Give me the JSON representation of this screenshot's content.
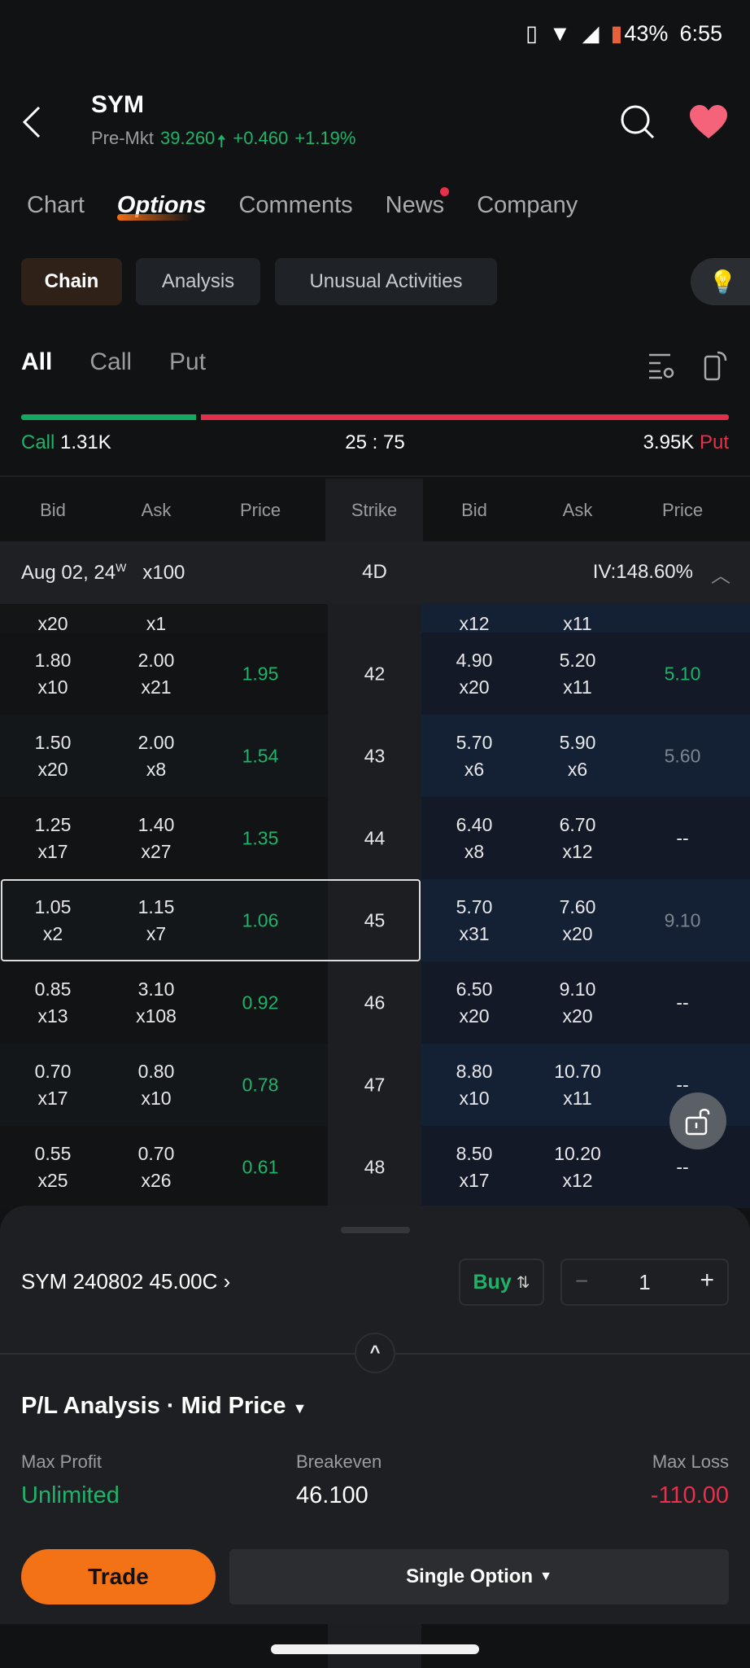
{
  "status": {
    "battery": "43%",
    "time": "6:55"
  },
  "header": {
    "symbol": "SYM",
    "session": "Pre-Mkt",
    "price": "39.260",
    "change": "+0.460",
    "change_pct": "+1.19%"
  },
  "tabs": [
    "Chart",
    "Options",
    "Comments",
    "News",
    "Company"
  ],
  "subtabs": [
    "Chain",
    "Analysis",
    "Unusual Activities"
  ],
  "filters": [
    "All",
    "Call",
    "Put"
  ],
  "ratio": {
    "call_label": "Call",
    "call_volume": "1.31K",
    "ratio": "25 : 75",
    "put_volume": "3.95K",
    "put_label": "Put",
    "call_fraction": 0.25
  },
  "columns": {
    "bid": "Bid",
    "ask": "Ask",
    "price": "Price",
    "strike": "Strike"
  },
  "expiry": {
    "date": "Aug 02, 24",
    "sup": "W",
    "multiplier": "x100",
    "days": "4D",
    "iv": "IV:148.60%"
  },
  "partial_row": {
    "call_bid_size": "x20",
    "call_ask_size": "x1",
    "put_bid_size": "x12",
    "put_ask_size": "x11"
  },
  "rows": [
    {
      "strike": "42",
      "cb": "1.80",
      "cbs": "x10",
      "ca": "2.00",
      "cas": "x21",
      "cp": "1.95",
      "pb": "4.90",
      "pbs": "x20",
      "pa": "5.20",
      "pas": "x11",
      "pp": "5.10"
    },
    {
      "strike": "43",
      "cb": "1.50",
      "cbs": "x20",
      "ca": "2.00",
      "cas": "x8",
      "cp": "1.54",
      "pb": "5.70",
      "pbs": "x6",
      "pa": "5.90",
      "pas": "x6",
      "pp": "5.60"
    },
    {
      "strike": "44",
      "cb": "1.25",
      "cbs": "x17",
      "ca": "1.40",
      "cas": "x27",
      "cp": "1.35",
      "pb": "6.40",
      "pbs": "x8",
      "pa": "6.70",
      "pas": "x12",
      "pp": "--"
    },
    {
      "strike": "45",
      "cb": "1.05",
      "cbs": "x2",
      "ca": "1.15",
      "cas": "x7",
      "cp": "1.06",
      "pb": "5.70",
      "pbs": "x31",
      "pa": "7.60",
      "pas": "x20",
      "pp": "9.10"
    },
    {
      "strike": "46",
      "cb": "0.85",
      "cbs": "x13",
      "ca": "3.10",
      "cas": "x108",
      "cp": "0.92",
      "pb": "6.50",
      "pbs": "x20",
      "pa": "9.10",
      "pas": "x20",
      "pp": "--"
    },
    {
      "strike": "47",
      "cb": "0.70",
      "cbs": "x17",
      "ca": "0.80",
      "cas": "x10",
      "cp": "0.78",
      "pb": "8.80",
      "pbs": "x10",
      "pa": "10.70",
      "pas": "x11",
      "pp": "--"
    },
    {
      "strike": "48",
      "cb": "0.55",
      "cbs": "x25",
      "ca": "0.70",
      "cas": "x26",
      "cp": "0.61",
      "pb": "8.50",
      "pbs": "x17",
      "pa": "10.20",
      "pas": "x12",
      "pp": "--"
    }
  ],
  "put_price_colors": [
    "#1fb36a",
    "#7d8490",
    "#e8e8ea",
    "#7d8490",
    "#e8e8ea",
    "#e8e8ea",
    "#e8e8ea"
  ],
  "order": {
    "contract": "SYM 240802 45.00C",
    "side": "Buy",
    "quantity": "1"
  },
  "pl": {
    "title": "P/L Analysis · Mid Price",
    "max_profit_label": "Max Profit",
    "max_profit": "Unlimited",
    "breakeven_label": "Breakeven",
    "breakeven": "46.100",
    "max_loss_label": "Max Loss",
    "max_loss": "-110.00"
  },
  "actions": {
    "trade": "Trade",
    "strategy": "Single Option"
  },
  "colors": {
    "accent": "#f37216",
    "up": "#1fb36a",
    "down": "#e8304a"
  }
}
